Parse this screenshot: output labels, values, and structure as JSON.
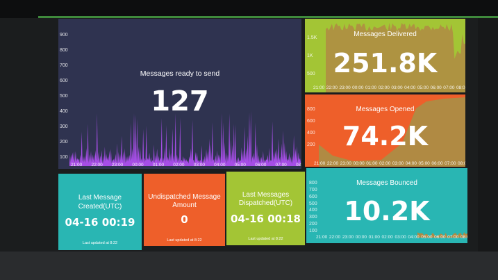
{
  "colors": {
    "dark_panel": "#2f3350",
    "purple": "#a64ee6",
    "olive": "#a3c535",
    "brown": "#b08a43",
    "orange": "#ee5f2a",
    "teal": "#29b6b3"
  },
  "ready_to_send": {
    "title": "Messages ready to send",
    "value": "127",
    "y_ticks": [
      "900",
      "800",
      "700",
      "600",
      "500",
      "400",
      "300",
      "200",
      "100"
    ],
    "x_ticks": [
      "21:00",
      "22:00",
      "23:00",
      "00:00",
      "01:00",
      "02:00",
      "03:00",
      "04:00",
      "05:00",
      "06:00",
      "07:00",
      "08:0"
    ]
  },
  "delivered": {
    "title": "Messages Delivered",
    "value": "251.8K",
    "y_ticks": [
      "1.5K",
      "1K",
      "500"
    ],
    "x_ticks": [
      "21:00",
      "22:00",
      "23:00",
      "00:00",
      "01:00",
      "02:00",
      "03:00",
      "04:00",
      "05:00",
      "06:00",
      "07:00",
      "08:00"
    ]
  },
  "opened": {
    "title": "Messages Opened",
    "value": "74.2K",
    "y_ticks": [
      "800",
      "600",
      "400",
      "200"
    ],
    "x_ticks": [
      "21:00",
      "22:00",
      "23:00",
      "00:00",
      "01:00",
      "02:00",
      "03:00",
      "04:00",
      "05:00",
      "06:00",
      "07:00",
      "08:00"
    ]
  },
  "bounced": {
    "title": "Messages Bounced",
    "value": "10.2K",
    "y_ticks": [
      "800",
      "700",
      "600",
      "500",
      "400",
      "300",
      "200",
      "100"
    ],
    "x_ticks": [
      "21:00",
      "22:00",
      "23:00",
      "00:00",
      "01:00",
      "02:00",
      "03:00",
      "04:00",
      "05:00",
      "06:00",
      "07:00",
      "08:00"
    ]
  },
  "last_created": {
    "title_line1": "Last Message",
    "title_line2": "Created(UTC)",
    "value": "04-16 00:19",
    "note": "Last updated at 8:22"
  },
  "undispatched": {
    "title_line1": "Undispatched Message",
    "title_line2": "Amount",
    "value": "0",
    "note": "Last updated at 8:22"
  },
  "last_dispatched": {
    "title_line1": "Last Messages",
    "title_line2": "Dispatched(UTC)",
    "value": "04-16 00:18",
    "note": "Last updated at 8:22"
  }
}
